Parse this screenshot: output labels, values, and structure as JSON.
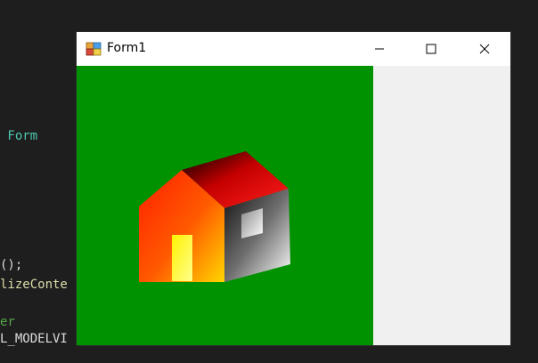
{
  "editor": {
    "lines": [
      {
        "text": " Form",
        "color": "#4ec9b0"
      },
      {
        "text": "();",
        "color": "#dcdcdc"
      },
      {
        "text": "lizeConte",
        "color": "#dcdcaa"
      },
      {
        "text": "er",
        "color": "#57a64a"
      },
      {
        "text": "L_MODELVI",
        "color": "#dcdcdc"
      }
    ]
  },
  "window": {
    "title": "Form1",
    "icon": "windows-forms-app-icon",
    "controls": {
      "minimize": "minimize-icon",
      "maximize": "maximize-icon",
      "close": "close-icon"
    }
  },
  "scene": {
    "background_color": "#009200",
    "client_color": "#f0f0f0",
    "object": "house"
  }
}
